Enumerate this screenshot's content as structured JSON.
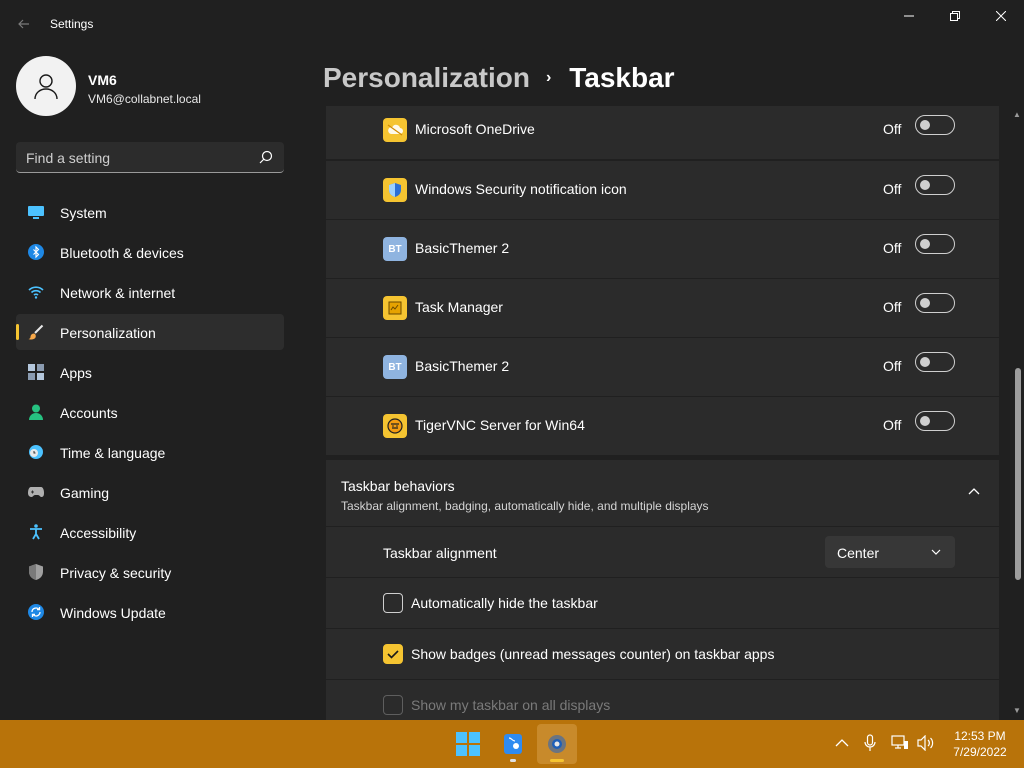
{
  "window": {
    "title": "Settings",
    "back_icon": "back-arrow-icon",
    "controls": [
      "minimize-icon",
      "maximize-icon",
      "close-icon"
    ]
  },
  "profile": {
    "name": "VM6",
    "email": "VM6@collabnet.local"
  },
  "search": {
    "placeholder": "Find a setting",
    "icon": "search-icon"
  },
  "sidebar": {
    "active_index": 3,
    "items": [
      {
        "label": "System",
        "icon": "system-icon"
      },
      {
        "label": "Bluetooth & devices",
        "icon": "bluetooth-icon"
      },
      {
        "label": "Network & internet",
        "icon": "wifi-icon"
      },
      {
        "label": "Personalization",
        "icon": "brush-icon"
      },
      {
        "label": "Apps",
        "icon": "apps-icon"
      },
      {
        "label": "Accounts",
        "icon": "person-icon"
      },
      {
        "label": "Time & language",
        "icon": "globe-clock-icon"
      },
      {
        "label": "Gaming",
        "icon": "gamepad-icon"
      },
      {
        "label": "Accessibility",
        "icon": "accessibility-icon"
      },
      {
        "label": "Privacy & security",
        "icon": "shield-icon"
      },
      {
        "label": "Windows Update",
        "icon": "update-icon"
      }
    ]
  },
  "breadcrumb": {
    "parent": "Personalization",
    "separator": "›",
    "current": "Taskbar"
  },
  "tray_apps": [
    {
      "label": "Microsoft OneDrive",
      "state": "Off",
      "icon": "onedrive-icon"
    },
    {
      "label": "Windows Security notification icon",
      "state": "Off",
      "icon": "windows-security-icon"
    },
    {
      "label": "BasicThemer 2",
      "state": "Off",
      "icon": "basicthemer-icon",
      "badge": "BT"
    },
    {
      "label": "Task Manager",
      "state": "Off",
      "icon": "task-manager-icon"
    },
    {
      "label": "BasicThemer 2",
      "state": "Off",
      "icon": "basicthemer-icon",
      "badge": "BT"
    },
    {
      "label": "TigerVNC Server for Win64",
      "state": "Off",
      "icon": "tigervnc-icon"
    }
  ],
  "taskbar_behaviors": {
    "title": "Taskbar behaviors",
    "subtitle": "Taskbar alignment, badging, automatically hide, and multiple displays",
    "expanded": true,
    "alignment": {
      "label": "Taskbar alignment",
      "value": "Center"
    },
    "auto_hide": {
      "label": "Automatically hide the taskbar",
      "checked": false,
      "disabled": false
    },
    "badges": {
      "label": "Show badges (unread messages counter) on taskbar apps",
      "checked": true,
      "disabled": false
    },
    "all_displays": {
      "label": "Show my taskbar on all displays",
      "checked": false,
      "disabled": true
    }
  },
  "taskbar": {
    "apps": [
      "start-icon",
      "file-explorer-icon",
      "settings-icon"
    ],
    "tray_icons": [
      "chevron-up-icon",
      "microphone-icon",
      "network-icon",
      "volume-icon"
    ],
    "time": "12:53 PM",
    "date": "7/29/2022"
  },
  "colors": {
    "accent": "#f5c431",
    "taskbar": "#b8730a",
    "background": "#202020",
    "card": "#2b2b2b"
  }
}
